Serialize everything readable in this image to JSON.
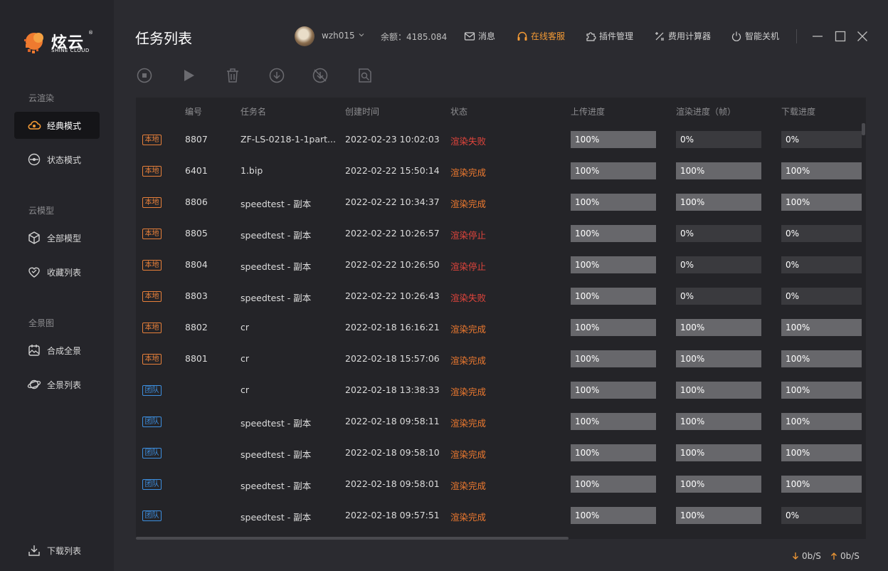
{
  "app": {
    "logo_text": "炫云",
    "logo_sub": "SHINE CLOUD"
  },
  "sidebar": {
    "sections": [
      {
        "title": "云渲染",
        "items": [
          {
            "label": "经典模式",
            "icon": "cloud-icon",
            "active": true
          },
          {
            "label": "状态模式",
            "icon": "gauge-icon"
          }
        ]
      },
      {
        "title": "云模型",
        "items": [
          {
            "label": "全部模型",
            "icon": "cube-icon"
          },
          {
            "label": "收藏列表",
            "icon": "heart-icon"
          }
        ]
      },
      {
        "title": "全景图",
        "items": [
          {
            "label": "合成全景",
            "icon": "panorama-icon"
          },
          {
            "label": "全景列表",
            "icon": "planet-icon"
          }
        ]
      }
    ],
    "download_list": "下载列表"
  },
  "header": {
    "title": "任务列表",
    "username": "wzh015",
    "balance": "余额：4185.084",
    "messages": "消息",
    "support": "在线客服",
    "plugins": "插件管理",
    "calculator": "费用计算器",
    "shutdown": "智能关机"
  },
  "colors": {
    "accent": "#f39a35",
    "local_tag": "#e8803a",
    "team_tag": "#3d8fe0",
    "status_fail": "#e2453c",
    "status_done": "#ef7a2f"
  },
  "table": {
    "columns": [
      "编号",
      "任务名",
      "创建时间",
      "状态",
      "上传进度",
      "渲染进度（帧）",
      "下载进度"
    ],
    "rows": [
      {
        "tag": "本地",
        "tag_type": "local",
        "id": "8807",
        "name": "ZF-LS-0218-1-1part...",
        "created": "2022-02-23 10:02:03",
        "status": "渲染失败",
        "status_type": "red",
        "upload": "100%",
        "upload_v": 1,
        "render": "0%",
        "render_v": 0,
        "download": "0%",
        "download_v": 0
      },
      {
        "tag": "本地",
        "tag_type": "local",
        "id": "6401",
        "name": "1.bip",
        "created": "2022-02-22 15:50:14",
        "status": "渲染完成",
        "status_type": "orange",
        "upload": "100%",
        "upload_v": 1,
        "render": "100%",
        "render_v": 1,
        "download": "100%",
        "download_v": 1
      },
      {
        "tag": "本地",
        "tag_type": "local",
        "id": "8806",
        "name": "speedtest - 副本",
        "created": "2022-02-22 10:34:37",
        "status": "渲染完成",
        "status_type": "orange",
        "upload": "100%",
        "upload_v": 1,
        "render": "100%",
        "render_v": 1,
        "download": "100%",
        "download_v": 1
      },
      {
        "tag": "本地",
        "tag_type": "local",
        "id": "8805",
        "name": "speedtest - 副本",
        "created": "2022-02-22 10:26:57",
        "status": "渲染停止",
        "status_type": "red",
        "upload": "100%",
        "upload_v": 1,
        "render": "0%",
        "render_v": 0,
        "download": "0%",
        "download_v": 0
      },
      {
        "tag": "本地",
        "tag_type": "local",
        "id": "8804",
        "name": "speedtest - 副本",
        "created": "2022-02-22 10:26:50",
        "status": "渲染停止",
        "status_type": "red",
        "upload": "100%",
        "upload_v": 1,
        "render": "0%",
        "render_v": 0,
        "download": "0%",
        "download_v": 0
      },
      {
        "tag": "本地",
        "tag_type": "local",
        "id": "8803",
        "name": "speedtest - 副本",
        "created": "2022-02-22 10:26:43",
        "status": "渲染失败",
        "status_type": "red",
        "upload": "100%",
        "upload_v": 1,
        "render": "0%",
        "render_v": 0,
        "download": "0%",
        "download_v": 0
      },
      {
        "tag": "本地",
        "tag_type": "local",
        "id": "8802",
        "name": "cr",
        "created": "2022-02-18 16:16:21",
        "status": "渲染完成",
        "status_type": "orange",
        "upload": "100%",
        "upload_v": 1,
        "render": "100%",
        "render_v": 1,
        "download": "100%",
        "download_v": 1
      },
      {
        "tag": "本地",
        "tag_type": "local",
        "id": "8801",
        "name": "cr",
        "created": "2022-02-18 15:57:06",
        "status": "渲染完成",
        "status_type": "orange",
        "upload": "100%",
        "upload_v": 1,
        "render": "100%",
        "render_v": 1,
        "download": "100%",
        "download_v": 1
      },
      {
        "tag": "团队",
        "tag_type": "team",
        "id": "",
        "name": "cr",
        "created": "2022-02-18 13:38:33",
        "status": "渲染完成",
        "status_type": "orange",
        "upload": "100%",
        "upload_v": 1,
        "render": "100%",
        "render_v": 1,
        "download": "100%",
        "download_v": 1
      },
      {
        "tag": "团队",
        "tag_type": "team",
        "id": "",
        "name": "speedtest - 副本",
        "created": "2022-02-18 09:58:11",
        "status": "渲染完成",
        "status_type": "orange",
        "upload": "100%",
        "upload_v": 1,
        "render": "100%",
        "render_v": 1,
        "download": "100%",
        "download_v": 1
      },
      {
        "tag": "团队",
        "tag_type": "team",
        "id": "",
        "name": "speedtest - 副本",
        "created": "2022-02-18 09:58:10",
        "status": "渲染完成",
        "status_type": "orange",
        "upload": "100%",
        "upload_v": 1,
        "render": "100%",
        "render_v": 1,
        "download": "100%",
        "download_v": 1
      },
      {
        "tag": "团队",
        "tag_type": "team",
        "id": "",
        "name": "speedtest - 副本",
        "created": "2022-02-18 09:58:01",
        "status": "渲染完成",
        "status_type": "orange",
        "upload": "100%",
        "upload_v": 1,
        "render": "100%",
        "render_v": 1,
        "download": "100%",
        "download_v": 1
      },
      {
        "tag": "团队",
        "tag_type": "team",
        "id": "",
        "name": "speedtest - 副本",
        "created": "2022-02-18 09:57:51",
        "status": "渲染完成",
        "status_type": "orange",
        "upload": "100%",
        "upload_v": 1,
        "render": "100%",
        "render_v": 1,
        "download": "0%",
        "download_v": 0
      }
    ]
  },
  "footer": {
    "download_speed": "0b/S",
    "upload_speed": "0b/S"
  }
}
